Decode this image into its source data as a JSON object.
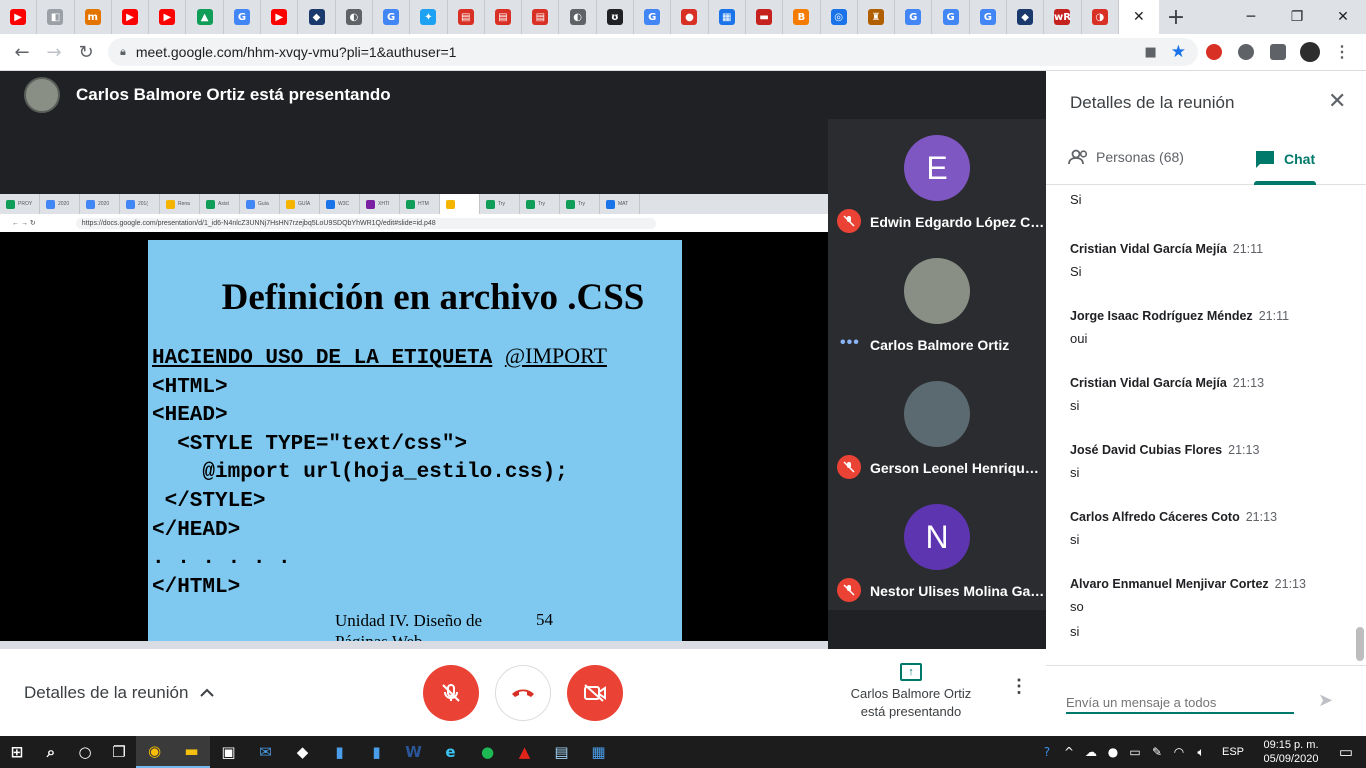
{
  "browser": {
    "tabs": [
      {
        "icon": "youtube-icon",
        "color": "#ff0000",
        "glyph": "▶"
      },
      {
        "icon": "site-icon",
        "color": "#9aa0a6",
        "glyph": "◧"
      },
      {
        "icon": "site-icon",
        "color": "#e37400",
        "glyph": "m"
      },
      {
        "icon": "youtube-icon",
        "color": "#ff0000",
        "glyph": "▶"
      },
      {
        "icon": "youtube-icon",
        "color": "#ff0000",
        "glyph": "▶"
      },
      {
        "icon": "google-drive-icon",
        "color": "#0f9d58",
        "glyph": "▲"
      },
      {
        "icon": "google-icon",
        "color": "#4285f4",
        "glyph": "G"
      },
      {
        "icon": "youtube-icon",
        "color": "#ff0000",
        "glyph": "▶"
      },
      {
        "icon": "site-icon",
        "color": "#1a3a6e",
        "glyph": "◆"
      },
      {
        "icon": "globe-icon",
        "color": "#5f6368",
        "glyph": "◐"
      },
      {
        "icon": "google-icon",
        "color": "#4285f4",
        "glyph": "G"
      },
      {
        "icon": "twitter-icon",
        "color": "#1da1f2",
        "glyph": "✦"
      },
      {
        "icon": "video-icon",
        "color": "#d93025",
        "glyph": "▤"
      },
      {
        "icon": "video-icon",
        "color": "#d93025",
        "glyph": "▤"
      },
      {
        "icon": "video-icon",
        "color": "#d93025",
        "glyph": "▤"
      },
      {
        "icon": "globe-icon",
        "color": "#5f6368",
        "glyph": "◐"
      },
      {
        "icon": "site-icon",
        "color": "#202124",
        "glyph": "ʊ"
      },
      {
        "icon": "google-icon",
        "color": "#4285f4",
        "glyph": "G"
      },
      {
        "icon": "site-icon",
        "color": "#d93025",
        "glyph": "●"
      },
      {
        "icon": "site-icon",
        "color": "#1a73e8",
        "glyph": "▦"
      },
      {
        "icon": "site-icon",
        "color": "#c5221f",
        "glyph": "▬"
      },
      {
        "icon": "blogger-icon",
        "color": "#f57c00",
        "glyph": "B"
      },
      {
        "icon": "site-icon",
        "color": "#1a73e8",
        "glyph": "◎"
      },
      {
        "icon": "site-icon",
        "color": "#b06000",
        "glyph": "♜"
      },
      {
        "icon": "google-icon",
        "color": "#4285f4",
        "glyph": "G"
      },
      {
        "icon": "google-icon",
        "color": "#4285f4",
        "glyph": "G"
      },
      {
        "icon": "google-icon",
        "color": "#4285f4",
        "glyph": "G"
      },
      {
        "icon": "site-icon",
        "color": "#1a3a6e",
        "glyph": "◆"
      },
      {
        "icon": "wr-icon",
        "color": "#c5221f",
        "glyph": "wR"
      },
      {
        "icon": "site-icon",
        "color": "#d93025",
        "glyph": "◑"
      }
    ],
    "active_tab_icon": "meet-icon",
    "active_tab_close": "✕",
    "new_tab": "+",
    "window_controls": {
      "minimize": "─",
      "maximize": "❐",
      "close": "✕"
    },
    "nav": {
      "back": "←",
      "forward": "→",
      "reload": "↻"
    },
    "url": "meet.google.com/hhm-xvqy-vmu?pli=1&authuser=1"
  },
  "meet": {
    "presenter_banner": "Carlos Balmore Ortiz está presentando",
    "shared_screen": {
      "tab_labels": [
        "PROY",
        "2020",
        "2020",
        "201(",
        "Rena",
        "Asist",
        "Guía",
        "GUÍA",
        "W3C",
        "XHTI",
        "HTM",
        "",
        "Try",
        "Try",
        "Try",
        "MAT"
      ],
      "url": "https://docs.google.com/presentation/d/1_id6-N4nlcZ3UNNj7HsHN7rzejbq5LoU9SDQbYhWR1Q/edit#slide=id.p48",
      "slide": {
        "title": "Definición en archivo .CSS",
        "code_heading": "HACIENDO USO DE LA ETIQUETA",
        "code_heading_import": "@IMPORT",
        "lines": [
          "<HTML>",
          "<HEAD>",
          "  <STYLE TYPE=\"text/css\">",
          "    @import url(hoja_estilo.css);",
          " </STYLE>",
          "</HEAD>",
          ". . . . . .",
          "</HTML>"
        ],
        "footer_line1": "Unidad IV. Diseño de",
        "footer_line2": "Páginas Web",
        "page_number": "54"
      }
    },
    "participants": [
      {
        "initial": "E",
        "name": "Edwin Edgardo López Cuel...",
        "color": "#7e57c2",
        "status": "muted"
      },
      {
        "initial": "",
        "name": "Carlos Balmore Ortiz",
        "color": "#8a8f86",
        "status": "speaking"
      },
      {
        "initial": "",
        "name": "Gerson Leonel Henriquez ...",
        "color": "#5b6a70",
        "status": "muted"
      },
      {
        "initial": "N",
        "name": "Nestor Ulises Molina García",
        "color": "#5e35b1",
        "status": "muted"
      }
    ],
    "details_label": "Detalles de la reunión",
    "details_chevron": "^",
    "presenting_label": "Carlos Balmore Ortiz está presentando",
    "more_dots": "⋮"
  },
  "panel": {
    "title": "Detalles de la reunión",
    "close": "✕",
    "tab_people": "Personas (68)",
    "tab_chat": "Chat",
    "messages": [
      {
        "sender": "",
        "time": "",
        "text": "Si"
      },
      {
        "sender": "Cristian Vidal García Mejía",
        "time": "21:11",
        "text": "Si"
      },
      {
        "sender": "Jorge Isaac Rodríguez Méndez",
        "time": "21:11",
        "text": "oui"
      },
      {
        "sender": "Cristian Vidal García Mejía",
        "time": "21:13",
        "text": "si"
      },
      {
        "sender": "José David Cubias Flores",
        "time": "21:13",
        "text": "si"
      },
      {
        "sender": "Carlos Alfredo Cáceres Coto",
        "time": "21:13",
        "text": "si"
      },
      {
        "sender": "Alvaro Enmanuel Menjivar Cortez",
        "time": "21:13",
        "text": "so"
      },
      {
        "sender": "",
        "time": "",
        "text": "si"
      }
    ],
    "input_placeholder": "Envía un mensaje a todos",
    "send": "➤"
  },
  "colors": {
    "accent": "#00796b",
    "danger": "#ea4335",
    "meet_bg": "#202124"
  },
  "taskbar": {
    "apps": [
      "windows-start-icon",
      "search-icon",
      "cortana-icon",
      "task-view-icon",
      "chrome-icon",
      "file-explorer-icon",
      "store-icon",
      "mail-icon",
      "dropbox-icon",
      "app-icon",
      "app-icon",
      "word-icon",
      "edge-icon",
      "spotify-icon",
      "acrobat-icon",
      "notepad-icon",
      "photos-icon"
    ],
    "language": "ESP",
    "time": "09:15 p. m.",
    "date": "05/09/2020"
  }
}
